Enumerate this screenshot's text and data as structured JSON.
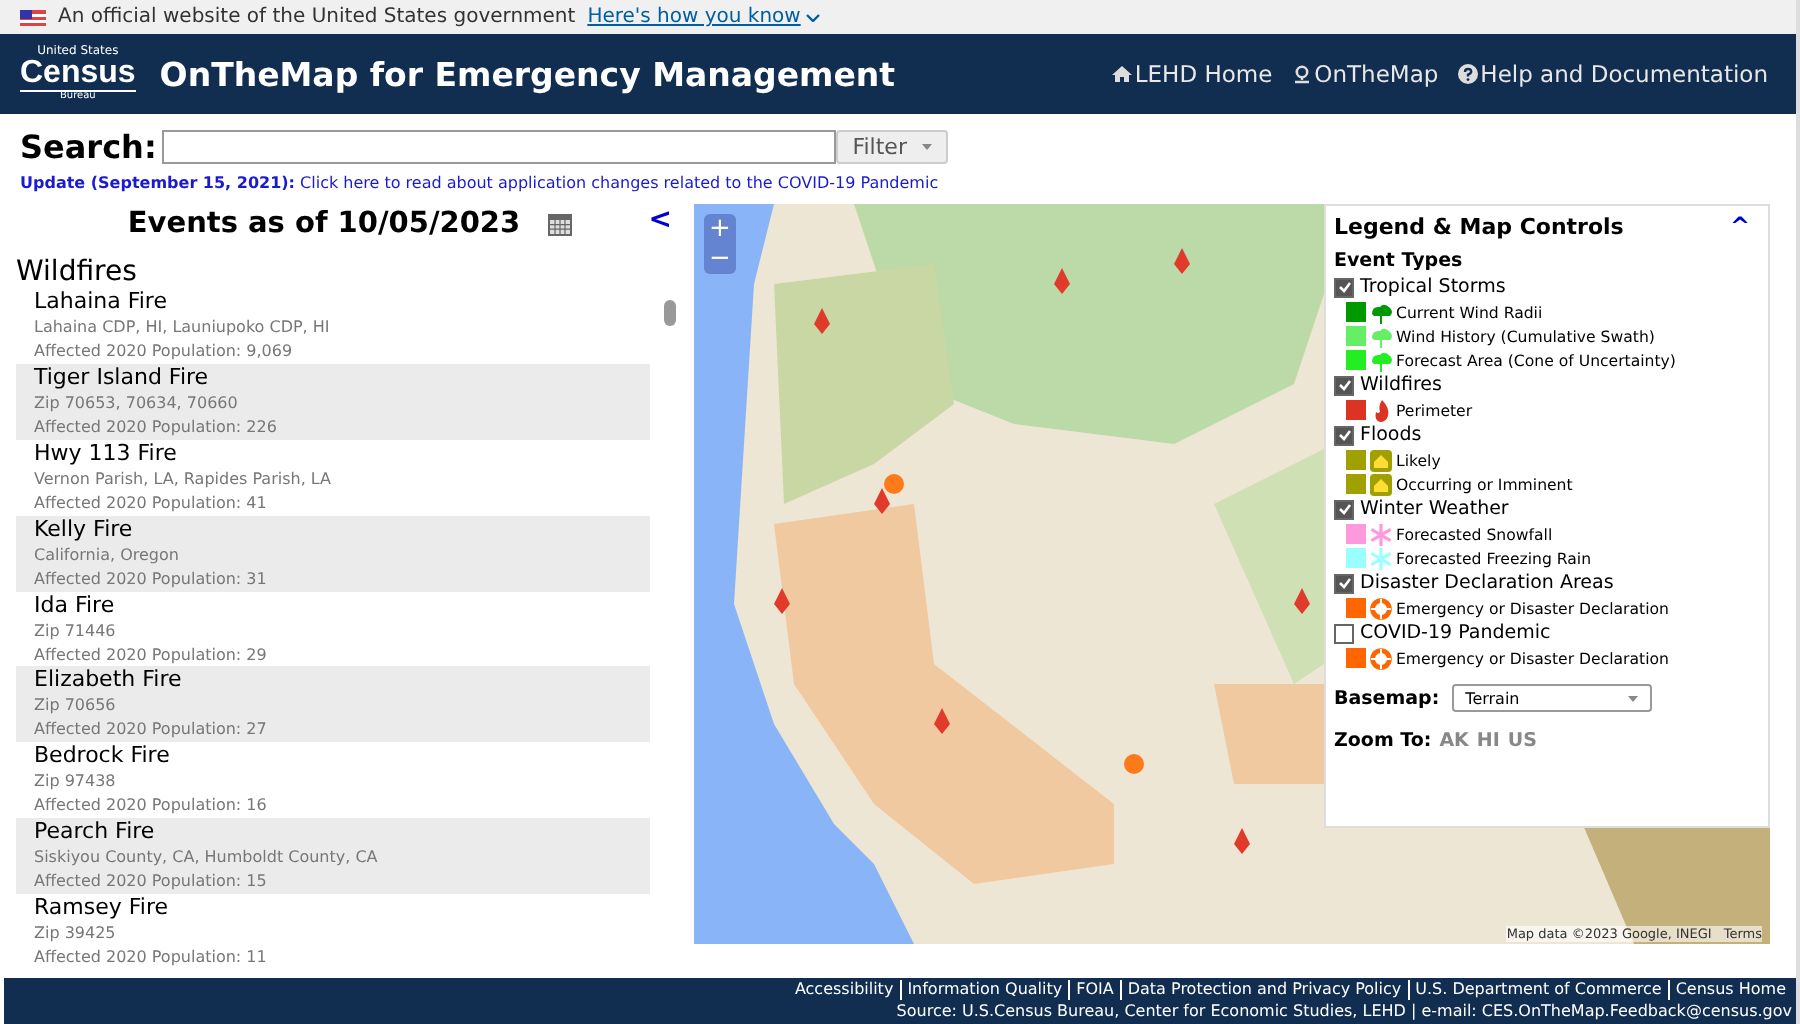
{
  "gov_banner": {
    "text": "An official website of the United States government",
    "link": "Here's how you know"
  },
  "header": {
    "logo_top": "United States",
    "logo_main": "Census",
    "logo_bottom": "Bureau",
    "title": "OnTheMap for Emergency Management",
    "nav": [
      {
        "label": "LEHD Home",
        "kind": "home"
      },
      {
        "label": "OnTheMap",
        "kind": "pin"
      },
      {
        "label": "Help and Documentation",
        "kind": "help"
      }
    ]
  },
  "search": {
    "label": "Search:",
    "button": "Filter"
  },
  "update": {
    "label": "Update (September 15, 2021):",
    "link": "Click here to read about application changes related to the COVID-19 Pandemic"
  },
  "events": {
    "title": "Events as of 10/05/2023",
    "collapse": "<",
    "category": "Wildfires",
    "items": [
      {
        "name": "Lahaina Fire",
        "area": "Lahaina CDP, HI, Launiupoko CDP, HI",
        "population": "Affected 2020 Population: 9,069"
      },
      {
        "name": "Tiger Island Fire",
        "area": "Zip 70653, 70634, 70660",
        "population": "Affected 2020 Population: 226"
      },
      {
        "name": "Hwy 113 Fire",
        "area": "Vernon Parish, LA, Rapides Parish, LA",
        "population": "Affected 2020 Population: 41"
      },
      {
        "name": "Kelly Fire",
        "area": "California, Oregon",
        "population": "Affected 2020 Population: 31"
      },
      {
        "name": "Ida Fire",
        "area": "Zip 71446",
        "population": "Affected 2020 Population: 29"
      },
      {
        "name": "Elizabeth Fire",
        "area": "Zip 70656",
        "population": "Affected 2020 Population: 27"
      },
      {
        "name": "Bedrock Fire",
        "area": "Zip 97438",
        "population": "Affected 2020 Population: 16"
      },
      {
        "name": "Pearch Fire",
        "area": "Siskiyou County, CA, Humboldt County, CA",
        "population": "Affected 2020 Population: 15"
      },
      {
        "name": "Ramsey Fire",
        "area": "Zip 39425",
        "population": "Affected 2020 Population: 11"
      }
    ]
  },
  "map": {
    "zoom_in": "+",
    "zoom_out": "−",
    "attribution": "Map data ©2023 Google, INEGI",
    "terms": "Terms"
  },
  "legend": {
    "title": "Legend & Map Controls",
    "collapse": "^",
    "section_title": "Event Types",
    "groups": [
      {
        "label": "Tropical Storms",
        "checked": true,
        "items": [
          {
            "label": "Current Wind Radii",
            "color": "#009900",
            "kind": "storm"
          },
          {
            "label": "Wind History (Cumulative Swath)",
            "color": "#66ee66",
            "kind": "storm"
          },
          {
            "label": "Forecast Area (Cone of Uncertainty)",
            "color": "#22ee22",
            "kind": "storm"
          }
        ]
      },
      {
        "label": "Wildfires",
        "checked": true,
        "items": [
          {
            "label": "Perimeter",
            "color": "#dd3322",
            "kind": "fire"
          }
        ]
      },
      {
        "label": "Floods",
        "checked": true,
        "items": [
          {
            "label": "Likely",
            "color": "#a0a000",
            "kind": "flood"
          },
          {
            "label": "Occurring or Imminent",
            "color": "#a0a000",
            "kind": "flood"
          }
        ]
      },
      {
        "label": "Winter Weather",
        "checked": true,
        "items": [
          {
            "label": "Forecasted Snowfall",
            "color": "#ff99dd",
            "kind": "snow"
          },
          {
            "label": "Forecasted Freezing Rain",
            "color": "#99ffff",
            "kind": "snow"
          }
        ]
      },
      {
        "label": "Disaster Declaration Areas",
        "checked": true,
        "items": [
          {
            "label": "Emergency or Disaster Declaration",
            "color": "#ff6600",
            "kind": "ring"
          }
        ]
      },
      {
        "label": "COVID-19 Pandemic",
        "checked": false,
        "items": [
          {
            "label": "Emergency or Disaster Declaration",
            "color": "#ff6600",
            "kind": "ring"
          }
        ]
      }
    ],
    "basemap_label": "Basemap:",
    "basemap": "Terrain",
    "zoom_label": "Zoom To:",
    "zoom_links": [
      "AK",
      "HI",
      "US"
    ]
  },
  "footer": {
    "links": [
      "Accessibility",
      "Information Quality",
      "FOIA",
      "Data Protection and Privacy Policy",
      "U.S. Department of Commerce",
      "Census Home"
    ],
    "source": "Source: U.S.Census Bureau, Center for Economic Studies, LEHD | e-mail: CES.OnTheMap.Feedback@census.gov"
  }
}
